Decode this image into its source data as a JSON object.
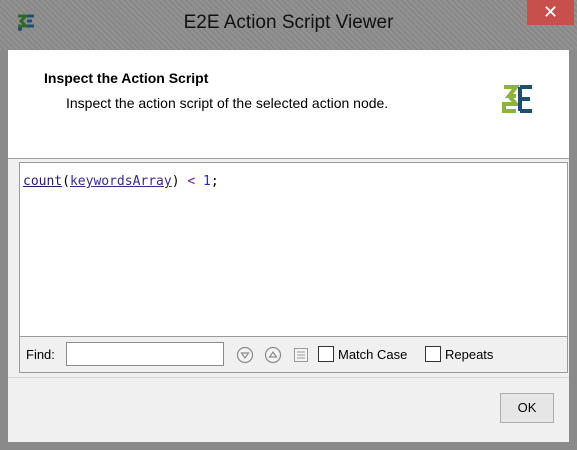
{
  "window": {
    "title": "E2E Action Script Viewer",
    "close_symbol": "✕",
    "accent_close": "#c7504d",
    "icons": [
      "app-icon",
      "close-icon"
    ]
  },
  "header": {
    "title": "Inspect the Action Script",
    "description": "Inspect the action script of the selected action node.",
    "logo_icon": "e2e-logo-icon"
  },
  "editor": {
    "code": {
      "fn": "count",
      "open": "(",
      "var": "keywordsArray",
      "close": ")",
      "op": "<",
      "num": "1",
      "end": ";"
    }
  },
  "find_bar": {
    "label": "Find:",
    "input_value": "",
    "input_placeholder": "",
    "icons": [
      "find-next-icon",
      "find-previous-icon",
      "highlight-all-icon"
    ],
    "match_case_label": "Match Case",
    "match_case_checked": false,
    "repeats_label": "Repeats",
    "repeats_checked": false
  },
  "footer": {
    "ok_label": "OK"
  }
}
